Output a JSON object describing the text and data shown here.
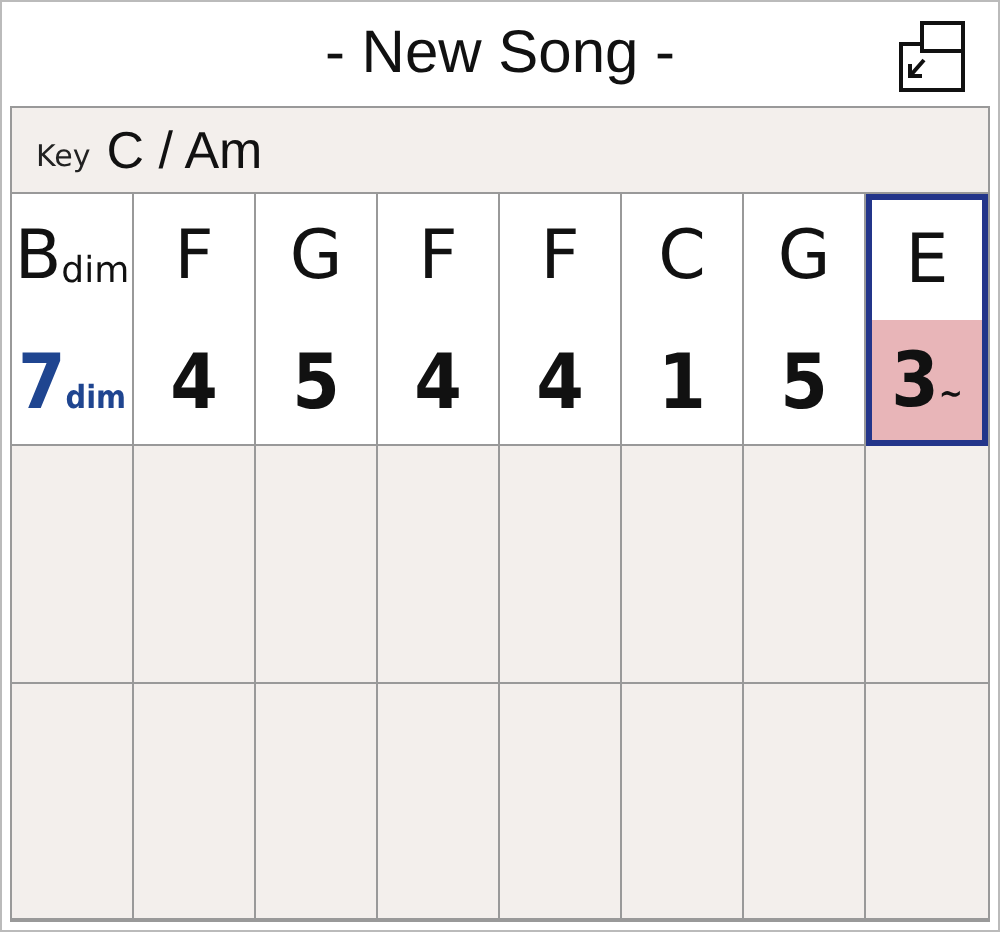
{
  "title": "- New Song -",
  "key": {
    "label": "Key",
    "value": "C / Am"
  },
  "chords": [
    {
      "root": "B",
      "quality": "dim",
      "degree": "7",
      "degree_suffix": "dim",
      "color": "#1f4590",
      "highlighted": false,
      "selected": false
    },
    {
      "root": "F",
      "degree": "4",
      "color": "#111111",
      "highlighted": false,
      "selected": false
    },
    {
      "root": "G",
      "degree": "5",
      "color": "#111111",
      "highlighted": false,
      "selected": false
    },
    {
      "root": "F",
      "degree": "4",
      "color": "#111111",
      "highlighted": false,
      "selected": false
    },
    {
      "root": "F",
      "degree": "4",
      "color": "#111111",
      "highlighted": false,
      "selected": false
    },
    {
      "root": "C",
      "degree": "1",
      "color": "#111111",
      "highlighted": false,
      "selected": false
    },
    {
      "root": "G",
      "degree": "5",
      "color": "#111111",
      "highlighted": false,
      "selected": false
    },
    {
      "root": "E",
      "degree": "3",
      "degree_suffix": "~",
      "color": "#111111",
      "highlighted": true,
      "selected": true
    }
  ]
}
